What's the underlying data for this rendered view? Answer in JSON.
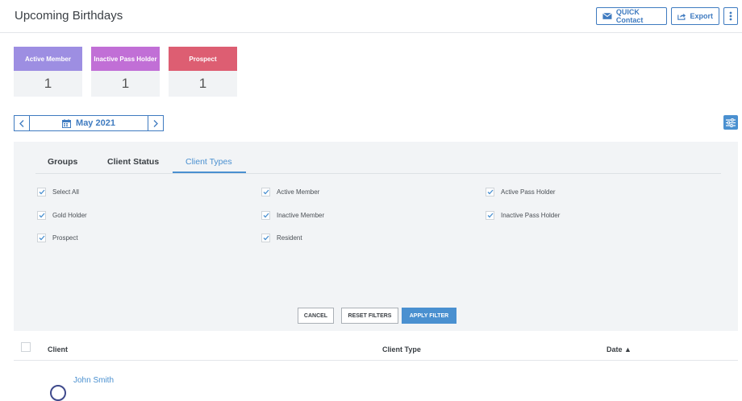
{
  "header": {
    "title": "Upcoming Birthdays",
    "quick_contact_label": "QUICK Contact",
    "export_label": "Export",
    "more_icon": "vertical-dots-icon"
  },
  "summary_cards": [
    {
      "label": "Active Member",
      "count": "1",
      "color": "#9d8ee2"
    },
    {
      "label": "Inactive Pass Holder",
      "count": "1",
      "color": "#c16fd6"
    },
    {
      "label": "Prospect",
      "count": "1",
      "color": "#dd5e72"
    }
  ],
  "month_nav": {
    "label": "May 2021",
    "prev_icon": "chevron-left-icon",
    "next_icon": "chevron-right-icon",
    "calendar_icon": "calendar-icon"
  },
  "filter_panel": {
    "tabs": [
      {
        "label": "Groups",
        "active": false
      },
      {
        "label": "Client Status",
        "active": false
      },
      {
        "label": "Client Types",
        "active": true
      }
    ],
    "checkboxes": [
      {
        "label": "Select All",
        "checked": true
      },
      {
        "label": "Active Member",
        "checked": true
      },
      {
        "label": "Active Pass Holder",
        "checked": true
      },
      {
        "label": "Gold Holder",
        "checked": true
      },
      {
        "label": "Inactive Member",
        "checked": true
      },
      {
        "label": "Inactive Pass Holder",
        "checked": true
      },
      {
        "label": "Prospect",
        "checked": true
      },
      {
        "label": "Resident",
        "checked": true
      }
    ],
    "buttons": {
      "cancel": "CANCEL",
      "reset": "RESET FILTERS",
      "apply": "APPLY FILTER"
    }
  },
  "table": {
    "columns": {
      "client": "Client",
      "client_type": "Client Type",
      "date": "Date ▲"
    },
    "rows": [
      {
        "client": "John Smith"
      }
    ]
  },
  "colors": {
    "accent": "#4a90d0",
    "border_blue": "#3f7bc0"
  }
}
